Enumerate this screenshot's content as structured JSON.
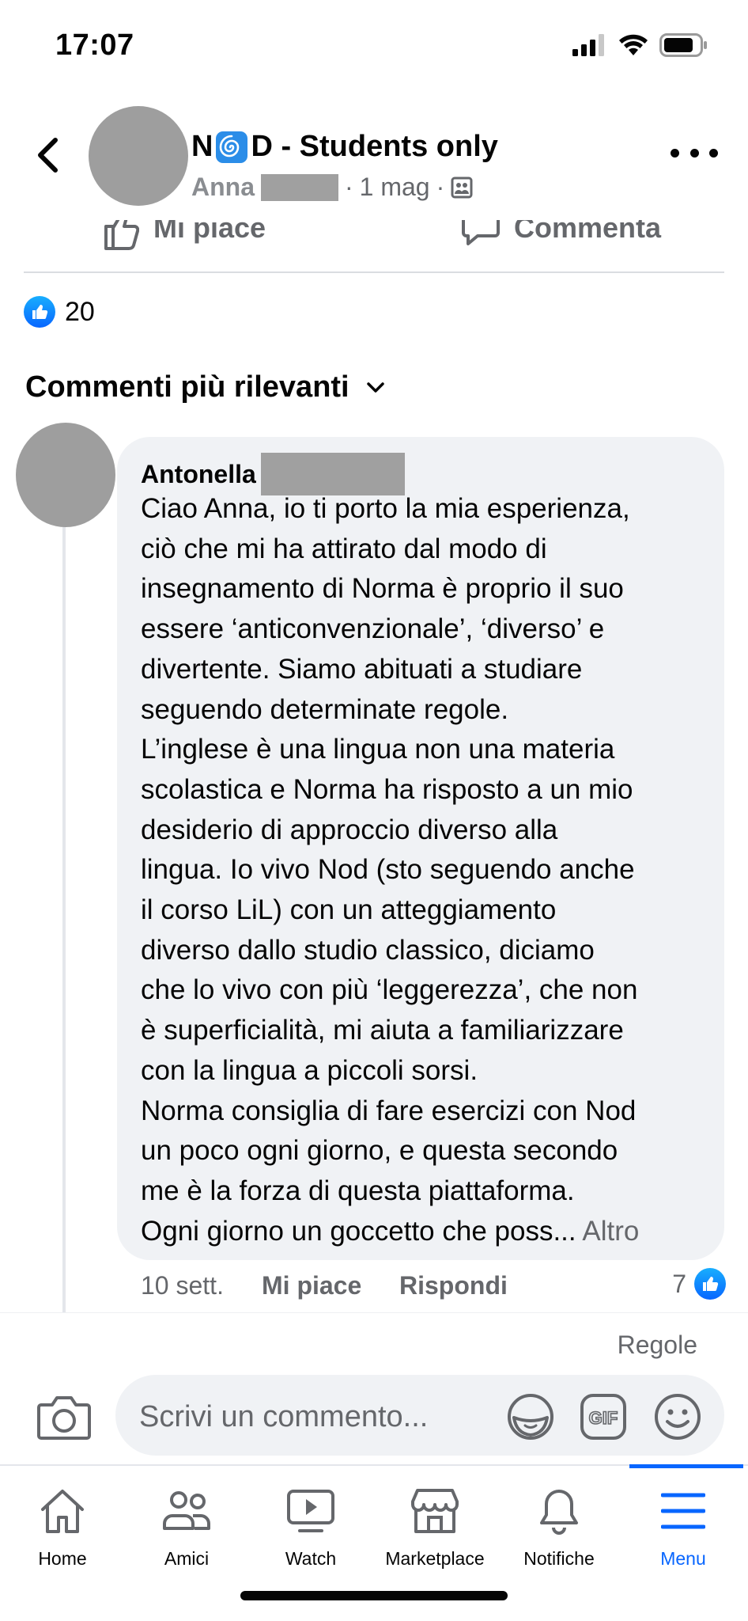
{
  "status_bar": {
    "time": "17:07",
    "icons": [
      "signal-icon",
      "wifi-icon",
      "battery-icon"
    ]
  },
  "header": {
    "group_title_prefix": "N",
    "group_title_suffix": "D - Students only",
    "group_title_emoji_icon": "cyclone-icon",
    "author": "Anna",
    "date": "1 mag",
    "privacy_icon": "group-members-icon",
    "separator": "·"
  },
  "actions": {
    "like_label": "Mi piace",
    "comment_label": "Commenta"
  },
  "reactions": {
    "count": "20"
  },
  "comments_sort": {
    "label": "Commenti più rilevanti"
  },
  "comment": {
    "author": "Antonella",
    "text": "Ciao Anna, io ti porto la mia esperienza,\nciò che mi ha attirato dal modo di\ninsegnamento di Norma è proprio il suo\nessere ‘anticonvenzionale’, ‘diverso’ e\ndivertente. Siamo abituati a studiare\nseguendo determinate regole.\nL’inglese è una lingua non una materia\nscolastica e Norma ha risposto a un mio\ndesiderio di approccio diverso alla\nlingua. Io vivo Nod (sto seguendo anche\nil corso LiL) con un atteggiamento\ndiverso dallo studio classico, diciamo\nche lo vivo con più ‘leggerezza’, che non\nè superficialità, mi aiuta a familiarizzare\ncon la lingua a piccoli sorsi.\nNorma consiglia di fare esercizi con Nod\nun poco ogni giorno, e questa secondo\nme è la forza di questa piattaforma.\nOgni giorno un goccetto che poss...",
    "more_label": "Altro",
    "time": "10 sett.",
    "like_label": "Mi piace",
    "reply_label": "Rispondi",
    "reaction_count": "7"
  },
  "composer": {
    "rules_label": "Regole",
    "placeholder": "Scrivi un commento...",
    "icons": [
      "camera-icon",
      "sticker-icon",
      "gif-icon",
      "emoji-icon"
    ]
  },
  "tabbar": {
    "tabs": [
      {
        "label": "Home",
        "icon": "home-icon"
      },
      {
        "label": "Amici",
        "icon": "friends-icon"
      },
      {
        "label": "Watch",
        "icon": "watch-icon"
      },
      {
        "label": "Marketplace",
        "icon": "marketplace-icon"
      },
      {
        "label": "Notifiche",
        "icon": "bell-icon"
      },
      {
        "label": "Menu",
        "icon": "menu-icon"
      }
    ],
    "active_tab": "Menu"
  },
  "colors": {
    "accent_blue": "#0866ff",
    "secondary_text": "#65676b",
    "bubble_bg": "#f0f2f5",
    "redaction_gray": "#a0a0a0"
  }
}
